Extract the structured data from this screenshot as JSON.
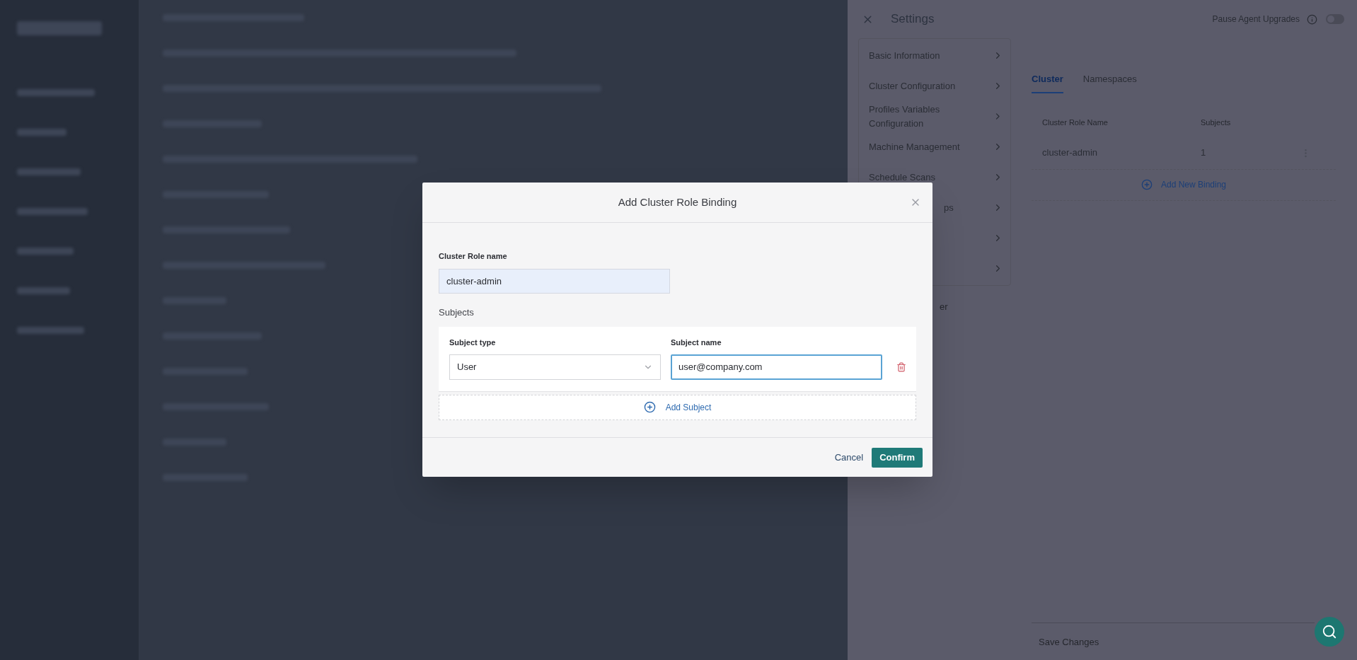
{
  "settings": {
    "title": "Settings",
    "pause_upgrades": {
      "label": "Pause Agent Upgrades",
      "on": false
    },
    "nav": [
      {
        "label": "Basic Information"
      },
      {
        "label": "Cluster Configuration"
      },
      {
        "label": "Profiles Variables Configuration"
      },
      {
        "label": "Machine Management"
      },
      {
        "label": "Schedule Scans"
      },
      {
        "label": "ps",
        "kind": "partly_covered"
      },
      {
        "kind": "covered"
      },
      {
        "kind": "covered"
      }
    ],
    "nav_footer": "er",
    "tabs": [
      {
        "label": "Cluster",
        "selected": true
      },
      {
        "label": "Namespaces",
        "selected": false
      }
    ],
    "table": {
      "columns": [
        "Cluster Role Name",
        "Subjects"
      ],
      "rows": [
        {
          "name": "cluster-admin",
          "subjects": "1"
        }
      ]
    },
    "add_binding": "Add New Binding",
    "save": "Save Changes"
  },
  "dialog": {
    "title": "Add Cluster Role Binding",
    "role_label": "Cluster Role name",
    "role_value": "cluster-admin",
    "subjects_label": "Subjects",
    "subjects": [
      {
        "type_label": "Subject type",
        "type_value": "User",
        "name_label": "Subject name",
        "name_value": "user@company.com"
      }
    ],
    "add_subject": "Add Subject",
    "buttons": [
      {
        "label": "Cancel",
        "kind": "text"
      },
      {
        "label": "Confirm",
        "kind": "primary"
      }
    ]
  }
}
